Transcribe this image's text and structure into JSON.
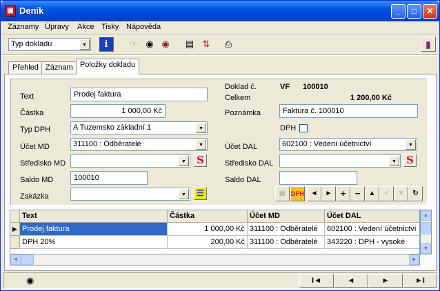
{
  "window": {
    "title": "Deník",
    "app_icon": "app-icon"
  },
  "menu": [
    "Záznamy",
    "Úpravy",
    "Akce",
    "Tisky",
    "Nápověda"
  ],
  "toolbar": {
    "doc_type_select": "Typ dokladu"
  },
  "tabs": [
    "Přehled",
    "Záznam",
    "Položky dokladu"
  ],
  "active_tab": "Položky dokladu",
  "form": {
    "text_label": "Text",
    "text_value": "Prodej faktura",
    "castka_label": "Částka",
    "castka_value": "1 000,00 Kč",
    "typdph_label": "Typ DPH",
    "typdph_value": "A Tuzemsko základní 1",
    "ucetmd_label": "Účet MD",
    "ucetmd_value": "311100 : Odběratelé",
    "strediskomd_label": "Středisko MD",
    "strediskomd_value": "",
    "saldomd_label": "Saldo MD",
    "saldomd_value": "100010",
    "zakazka_label": "Zakázka",
    "zakazka_value": "",
    "doklad_label": "Doklad č.",
    "doklad_series": "VF",
    "doklad_number": "100010",
    "celkem_label": "Celkem",
    "celkem_value": "1 200,00 Kč",
    "poznamka_label": "Poznámka",
    "poznamka_value": "Faktura č. 100010",
    "dph_label": "DPH",
    "ucetdal_label": "Účet DAL",
    "ucetdal_value": "602100 : Vedení účetnictví",
    "strediskodal_label": "Středisko DAL",
    "strediskodal_value": "",
    "saldodal_label": "Saldo DAL",
    "saldodal_value": "",
    "dph_button": "DPH"
  },
  "grid": {
    "columns": [
      "Text",
      "Částka",
      "Účet MD",
      "Účet DAL"
    ],
    "rows": [
      [
        "Prodej faktura",
        "1 000,00 Kč",
        "311100 : Odběratelé",
        "602100 : Vedení účetnictví"
      ],
      [
        "DPH 20%",
        "200,00 Kč",
        "311100 : Odběratelé",
        "343220 : DPH - vysoké"
      ]
    ]
  },
  "status_nav": [
    "I◄",
    "◄",
    "►",
    "►I"
  ],
  "colors": {
    "title_bar": "#0054e3",
    "selection": "#316ac5",
    "accent_red": "#c8102e"
  }
}
